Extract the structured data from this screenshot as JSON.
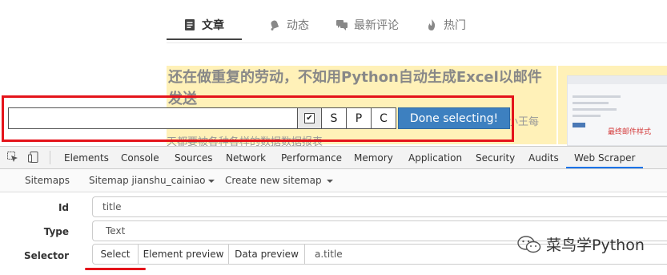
{
  "site": {
    "tabs": [
      {
        "label": "文章",
        "icon": "document-icon",
        "active": true
      },
      {
        "label": "动态",
        "icon": "bell-icon",
        "active": false
      },
      {
        "label": "最新评论",
        "icon": "comments-icon",
        "active": false
      },
      {
        "label": "热门",
        "icon": "flame-icon",
        "active": false
      }
    ],
    "article": {
      "title": "还在做重复的劳动，不如用Python自动生成Excel以邮件发送",
      "snippet": "天都要被各种各样的数据数据报表",
      "side_text": "小王每",
      "thumb_label": "最终邮件样式"
    }
  },
  "selector_bar": {
    "input_value": "",
    "checkbox_mark": "✔",
    "buttons": [
      "S",
      "P",
      "C"
    ],
    "done_label": "Done selecting!"
  },
  "devtools": {
    "tabs": [
      "Elements",
      "Console",
      "Sources",
      "Network",
      "Performance",
      "Memory",
      "Application",
      "Security",
      "Audits",
      "Web Scraper"
    ],
    "active_tab": "Web Scraper",
    "nav": {
      "sitemaps": "Sitemaps",
      "sitemap": "Sitemap jianshu_cainiao",
      "create": "Create new sitemap"
    },
    "form": {
      "id_label": "Id",
      "id_value": "title",
      "type_label": "Type",
      "type_value": "Text",
      "selector_label": "Selector",
      "select_btn": "Select",
      "element_preview_btn": "Element preview",
      "data_preview_btn": "Data preview",
      "selector_value": "a.title"
    }
  },
  "watermark": "菜鸟学Python",
  "colors": {
    "highlight": "#fff1b8",
    "red_annotation": "#e4141b",
    "done_button": "#3d80c0",
    "devtools_active_tab": "#1a73e8"
  }
}
